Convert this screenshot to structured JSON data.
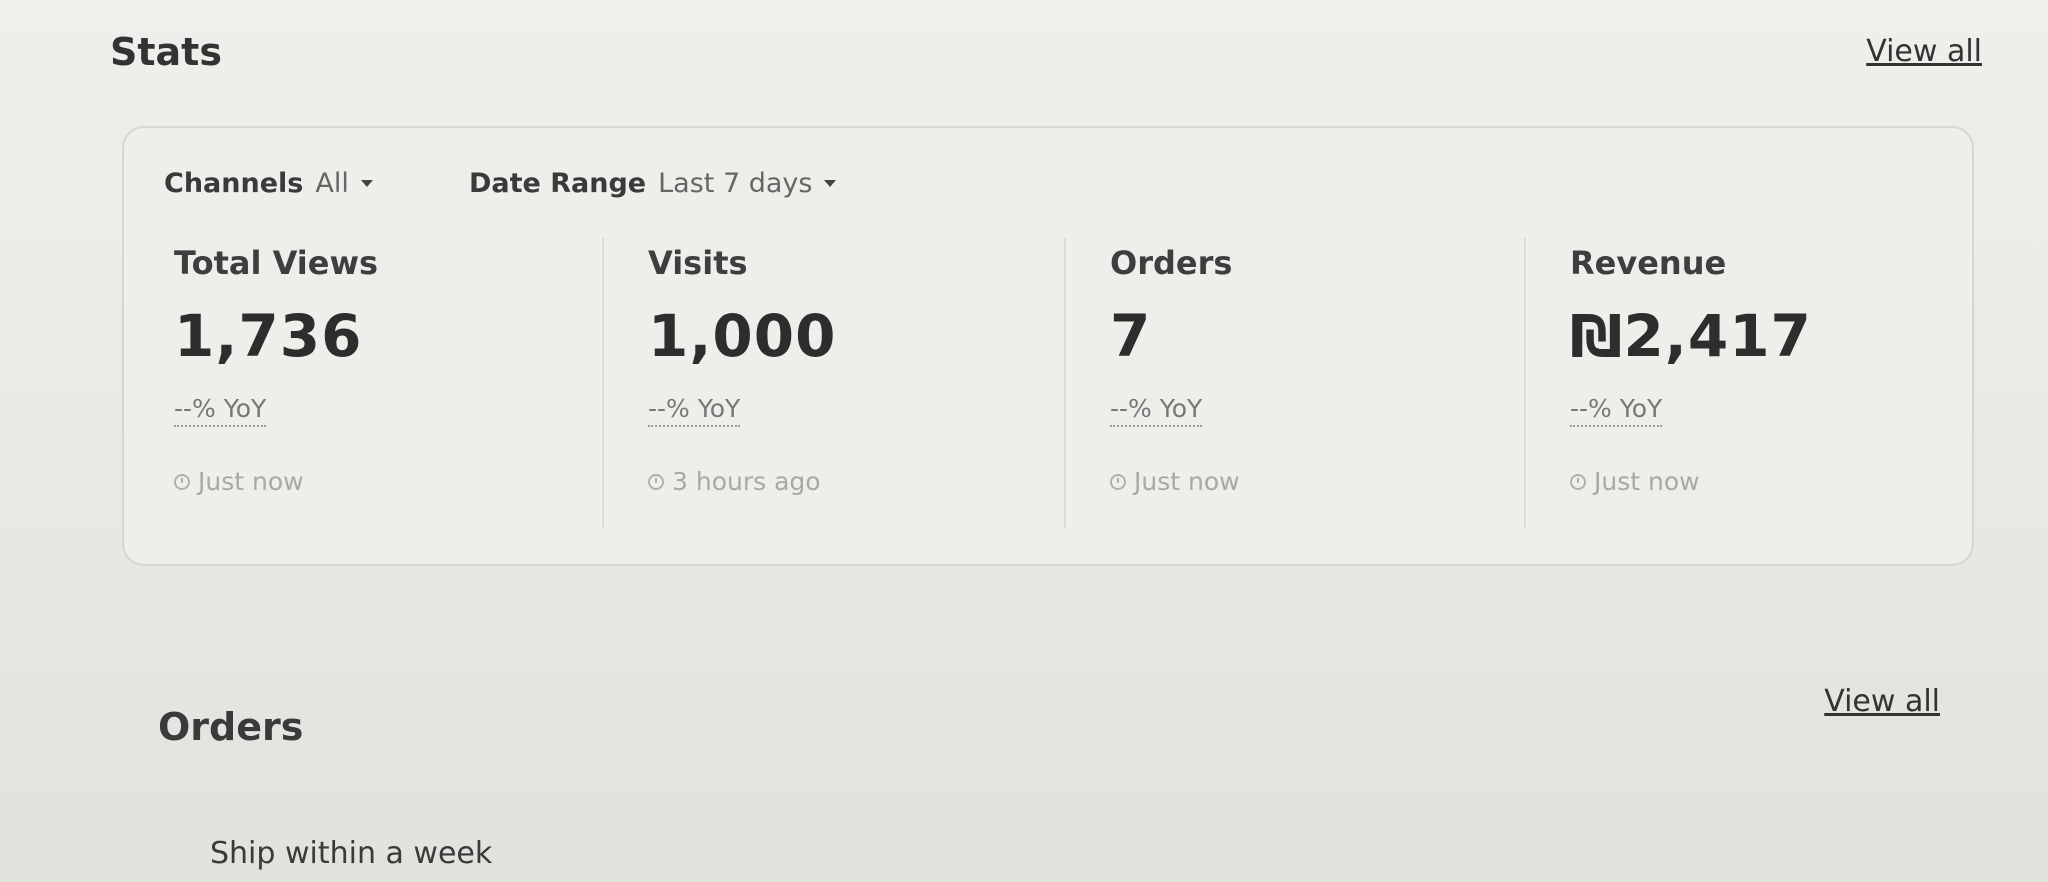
{
  "stats": {
    "title": "Stats",
    "view_all": "View all",
    "filters": {
      "channels_label": "Channels",
      "channels_value": "All",
      "date_label": "Date Range",
      "date_value": "Last 7 days"
    },
    "metrics": [
      {
        "label": "Total Views",
        "value": "1,736",
        "yoy": "--% YoY",
        "updated": "Just now"
      },
      {
        "label": "Visits",
        "value": "1,000",
        "yoy": "--% YoY",
        "updated": "3 hours ago"
      },
      {
        "label": "Orders",
        "value": "7",
        "yoy": "--% YoY",
        "updated": "Just now"
      },
      {
        "label": "Revenue",
        "value": "₪2,417",
        "yoy": "--% YoY",
        "updated": "Just now"
      }
    ]
  },
  "orders": {
    "title": "Orders",
    "view_all": "View all",
    "subsection": "Ship within a week"
  }
}
